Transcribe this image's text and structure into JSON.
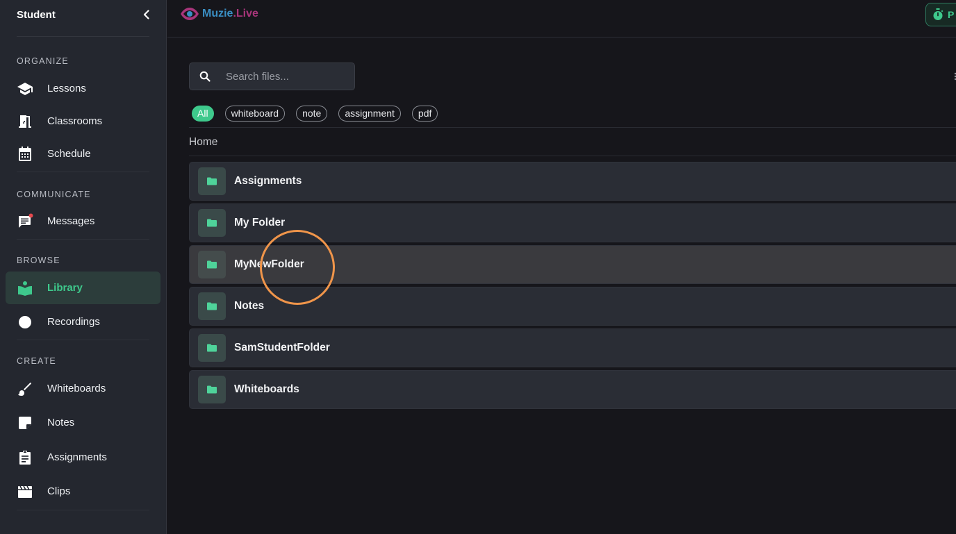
{
  "sidebar": {
    "title": "Student",
    "sections": [
      {
        "label": "ORGANIZE",
        "items": [
          {
            "label": "Lessons",
            "icon": "graduation-cap-icon"
          },
          {
            "label": "Classrooms",
            "icon": "door-icon"
          },
          {
            "label": "Schedule",
            "icon": "calendar-icon"
          }
        ]
      },
      {
        "label": "COMMUNICATE",
        "items": [
          {
            "label": "Messages",
            "icon": "message-icon"
          }
        ]
      },
      {
        "label": "BROWSE",
        "items": [
          {
            "label": "Library",
            "icon": "book-icon",
            "active": true
          },
          {
            "label": "Recordings",
            "icon": "record-icon"
          }
        ]
      },
      {
        "label": "CREATE",
        "items": [
          {
            "label": "Whiteboards",
            "icon": "brush-icon"
          },
          {
            "label": "Notes",
            "icon": "note-icon"
          },
          {
            "label": "Assignments",
            "icon": "clipboard-icon"
          },
          {
            "label": "Clips",
            "icon": "clapperboard-icon"
          }
        ]
      }
    ]
  },
  "topbar": {
    "logo_text_a": "Muzie",
    "logo_text_b": ".Live",
    "button_label": "P"
  },
  "search": {
    "placeholder": "Search files..."
  },
  "filters": [
    "All",
    "whiteboard",
    "note",
    "assignment",
    "pdf"
  ],
  "breadcrumb": "Home",
  "folders": [
    {
      "name": "Assignments"
    },
    {
      "name": "My Folder"
    },
    {
      "name": "MyNewFolder",
      "hovered": true
    },
    {
      "name": "Notes"
    },
    {
      "name": "SamStudentFolder"
    },
    {
      "name": "Whiteboards"
    }
  ],
  "colors": {
    "accent": "#3ec98c",
    "sidebar_bg": "#24272f",
    "main_bg": "#16161b",
    "cursor_ring": "#f0954a"
  }
}
